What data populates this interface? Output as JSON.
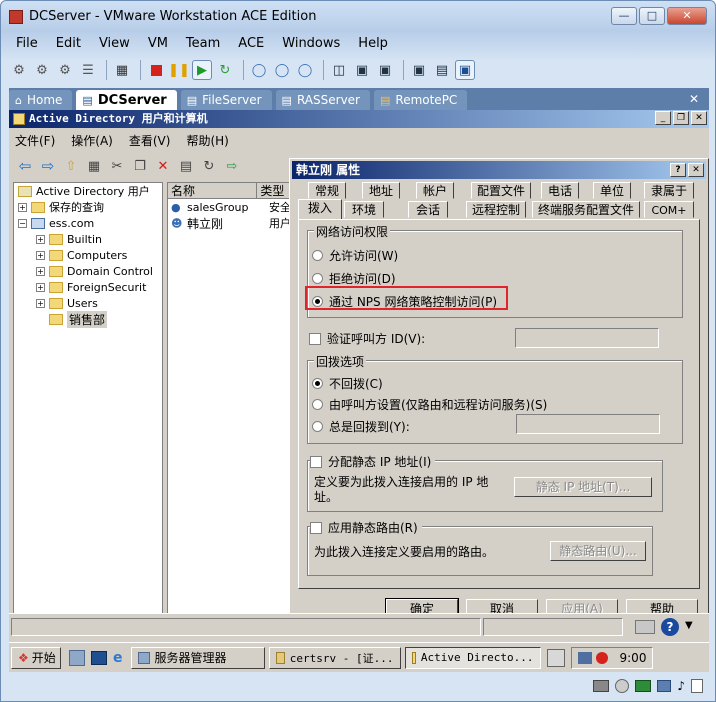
{
  "vmware": {
    "title": "DCServer - VMware Workstation ACE Edition",
    "menu": [
      "File",
      "Edit",
      "View",
      "VM",
      "Team",
      "ACE",
      "Windows",
      "Help"
    ],
    "tabs": [
      {
        "label": "Home",
        "active": false
      },
      {
        "label": "DCServer",
        "active": true
      },
      {
        "label": "FileServer",
        "active": false
      },
      {
        "label": "RASServer",
        "active": false
      },
      {
        "label": "RemotePC",
        "active": false
      }
    ],
    "tab_close": "✕"
  },
  "mmc": {
    "title": "Active Directory 用户和计算机",
    "menu": [
      "文件(F)",
      "操作(A)",
      "查看(V)",
      "帮助(H)"
    ],
    "tree": {
      "root": "Active Directory 用户",
      "saved_queries": "保存的查询",
      "domain": "ess.com",
      "children": [
        "Builtin",
        "Computers",
        "Domain Control",
        "ForeignSecurit",
        "Users",
        "销售部"
      ]
    },
    "list": {
      "columns": [
        "名称",
        "类型"
      ],
      "rows": [
        {
          "name": "salesGroup",
          "type": "安全"
        },
        {
          "name": "韩立刚",
          "type": "用户"
        }
      ]
    }
  },
  "dialog": {
    "title": "韩立刚 属性",
    "help_btn": "?",
    "close_btn": "✕",
    "tabs_row1": [
      "常规",
      "地址",
      "帐户",
      "配置文件",
      "电话",
      "单位",
      "隶属于"
    ],
    "tabs_row2": [
      "拨入",
      "环境",
      "会话",
      "远程控制",
      "终端服务配置文件",
      "COM+"
    ],
    "network_access": {
      "label": "网络访问权限",
      "options": [
        "允许访问(W)",
        "拒绝访问(D)",
        "通过 NPS 网络策略控制访问(P)"
      ],
      "selected": 2
    },
    "verify_caller": "验证呼叫方 ID(V):",
    "callback": {
      "label": "回拨选项",
      "options": [
        "不回拨(C)",
        "由呼叫方设置(仅路由和远程访问服务)(S)",
        "总是回拨到(Y):"
      ],
      "selected": 0
    },
    "static_ip": {
      "label": "分配静态 IP 地址(I)",
      "desc": "定义要为此拨入连接启用的 IP 地址。",
      "button": "静态 IP 地址(T)..."
    },
    "static_routes": {
      "label": "应用静态路由(R)",
      "desc": "为此拨入连接定义要启用的路由。",
      "button": "静态路由(U)..."
    },
    "buttons": {
      "ok": "确定",
      "cancel": "取消",
      "apply": "应用(A)",
      "help": "帮助"
    }
  },
  "taskbar": {
    "start": "开始",
    "tasks": [
      "服务器管理器",
      "certsrv - [证...",
      "Active Directo..."
    ],
    "clock": "9:00"
  },
  "colors": {
    "accent_red": "#e0242b",
    "title_blue": "#0a246a",
    "vm_tab_bar": "#5c7ea8"
  }
}
